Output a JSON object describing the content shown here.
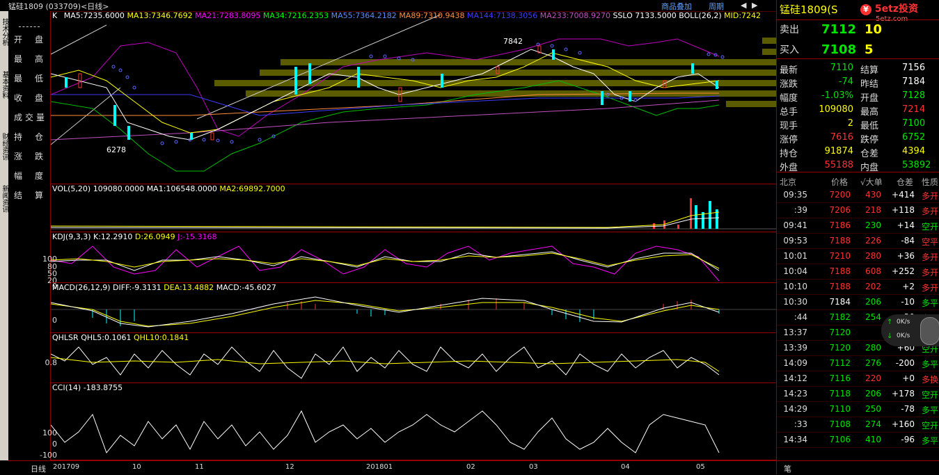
{
  "window": {
    "title": "锰硅1809 (033709)<日线>",
    "buttons": [
      "商品叠加",
      "周期"
    ]
  },
  "left_tabs": [
    "技术分析",
    "基本资料",
    "财经资讯",
    "新闻资讯"
  ],
  "left_menu": [
    "开盘",
    "最高",
    "最低",
    "收盘",
    "成交量",
    "持仓",
    "涨跌",
    "幅度",
    "结算"
  ],
  "main_pane": {
    "label": "K",
    "indicators": [
      {
        "text": "MA5:7235.6000",
        "color": "#ffffff"
      },
      {
        "text": "MA13:7346.7692",
        "color": "#ffff00"
      },
      {
        "text": "MA21:7283.8095",
        "color": "#ff00ff"
      },
      {
        "text": "MA34:7216.2353",
        "color": "#00ff00"
      },
      {
        "text": "MA55:7364.2182",
        "color": "#5a8cff"
      },
      {
        "text": "MA89:7310.9438",
        "color": "#ff8c3c"
      },
      {
        "text": "MA144:7138.3056",
        "color": "#3c3cff"
      },
      {
        "text": "MA233:7008.9270",
        "color": "#c050c0"
      },
      {
        "text": "SSLO 7133.5000",
        "color": "#ffffff"
      },
      {
        "text": "BOLL(26,2)",
        "color": "#ffffff"
      },
      {
        "text": "MID:7242",
        "color": "#ffff00"
      }
    ],
    "high_label": "7842",
    "low_label": "6278"
  },
  "vol_pane": {
    "title": "VOL(5,20)",
    "values": [
      {
        "text": "109080.0000",
        "color": "#fff"
      },
      {
        "text": "MA1:106548.0000",
        "color": "#fff"
      },
      {
        "text": "MA2:69892.7000",
        "color": "#ffff00"
      }
    ]
  },
  "kdj_pane": {
    "title": "KDJ(9,3,3)",
    "values": [
      {
        "text": "K:12.2910",
        "color": "#fff"
      },
      {
        "text": "D:26.0949",
        "color": "#ffff00"
      },
      {
        "text": "J:-15.3168",
        "color": "#ff00ff"
      }
    ],
    "yticks": [
      "100",
      "80",
      "50",
      "20",
      "0"
    ]
  },
  "macd_pane": {
    "title": "MACD(26,12,9)",
    "values": [
      {
        "text": "DIFF:-9.3131",
        "color": "#fff"
      },
      {
        "text": "DEA:13.4882",
        "color": "#ffff00"
      },
      {
        "text": "MACD:-45.6027",
        "color": "#fff"
      }
    ],
    "yticks": [
      "0"
    ]
  },
  "qhlsr_pane": {
    "title": "QHLSR",
    "values": [
      {
        "text": "QHL5:0.1061",
        "color": "#fff"
      },
      {
        "text": "QHL10:0.1841",
        "color": "#ffff00"
      }
    ],
    "yticks": [
      "0.8"
    ]
  },
  "cci_pane": {
    "title": "CCI(14)",
    "values": [
      {
        "text": "-183.8755",
        "color": "#fff"
      }
    ],
    "yticks": [
      "100",
      "0",
      "-100"
    ]
  },
  "x_axis": {
    "label": "日线",
    "ticks": [
      "201709",
      "10",
      "11",
      "12",
      "201801",
      "02",
      "03",
      "04",
      "05"
    ]
  },
  "right_panel": {
    "name": "锰硅1809",
    "code_partial": "(S",
    "sell": {
      "label": "卖出",
      "price": "7112",
      "qty": "10"
    },
    "buy": {
      "label": "买入",
      "price": "7108",
      "qty": "5"
    },
    "stats": [
      {
        "l1": "最新",
        "v1": "7110",
        "c1": "green",
        "l2": "结算",
        "v2": "7156",
        "c2": "white"
      },
      {
        "l1": "涨跌",
        "v1": "-74",
        "c1": "green",
        "l2": "昨结",
        "v2": "7184",
        "c2": "white"
      },
      {
        "l1": "幅度",
        "v1": "-1.03%",
        "c1": "green",
        "l2": "开盘",
        "v2": "7128",
        "c2": "green"
      },
      {
        "l1": "总手",
        "v1": "109080",
        "c1": "yellow",
        "l2": "最高",
        "v2": "7214",
        "c2": "red"
      },
      {
        "l1": "现手",
        "v1": "2",
        "c1": "yellow",
        "l2": "最低",
        "v2": "7100",
        "c2": "green"
      },
      {
        "l1": "涨停",
        "v1": "7616",
        "c1": "red",
        "l2": "跌停",
        "v2": "6752",
        "c2": "green"
      },
      {
        "l1": "持仓",
        "v1": "91874",
        "c1": "yellow",
        "l2": "仓差",
        "v2": "4394",
        "c2": "yellow"
      },
      {
        "l1": "外盘",
        "v1": "55188",
        "c1": "red",
        "l2": "内盘",
        "v2": "53892",
        "c2": "green"
      }
    ],
    "tick_header": [
      "北京",
      "价格",
      "√大单",
      "仓差",
      "性质"
    ],
    "ticks": [
      {
        "time": "09:35",
        "price": "7200",
        "pc": "red",
        "vol": "430",
        "vc": "red",
        "oi": "+414",
        "oic": "white",
        "nat": "多开",
        "nc": "red"
      },
      {
        "time": ":39",
        "price": "7206",
        "pc": "red",
        "vol": "218",
        "vc": "red",
        "oi": "+118",
        "oic": "white",
        "nat": "多开",
        "nc": "red"
      },
      {
        "time": "09:41",
        "price": "7186",
        "pc": "red",
        "vol": "230",
        "vc": "green",
        "oi": "+14",
        "oic": "white",
        "nat": "空开",
        "nc": "green"
      },
      {
        "time": "09:53",
        "price": "7188",
        "pc": "red",
        "vol": "226",
        "vc": "red",
        "oi": "-84",
        "oic": "white",
        "nat": "空平",
        "nc": "red"
      },
      {
        "time": "10:01",
        "price": "7210",
        "pc": "red",
        "vol": "280",
        "vc": "red",
        "oi": "+36",
        "oic": "white",
        "nat": "多开",
        "nc": "red"
      },
      {
        "time": "10:04",
        "price": "7188",
        "pc": "red",
        "vol": "608",
        "vc": "red",
        "oi": "+252",
        "oic": "white",
        "nat": "多开",
        "nc": "red"
      },
      {
        "time": "10:10",
        "price": "7188",
        "pc": "red",
        "vol": "202",
        "vc": "red",
        "oi": "+2",
        "oic": "white",
        "nat": "多开",
        "nc": "red"
      },
      {
        "time": "10:30",
        "price": "7184",
        "pc": "white",
        "vol": "206",
        "vc": "green",
        "oi": "-10",
        "oic": "white",
        "nat": "多平",
        "nc": "green"
      },
      {
        "time": ":44",
        "price": "7182",
        "pc": "green",
        "vol": "254",
        "vc": "green",
        "oi": "+30",
        "oic": "white",
        "nat": "空开",
        "nc": "green"
      },
      {
        "time": "13:37",
        "price": "7120",
        "pc": "green",
        "vol": "",
        "vc": "green",
        "oi": "",
        "oic": "white",
        "nat": "",
        "nc": "green"
      },
      {
        "time": "13:39",
        "price": "7120",
        "pc": "green",
        "vol": "280",
        "vc": "green",
        "oi": "+60",
        "oic": "white",
        "nat": "空开",
        "nc": "green"
      },
      {
        "time": "14:09",
        "price": "7112",
        "pc": "green",
        "vol": "276",
        "vc": "green",
        "oi": "-200",
        "oic": "white",
        "nat": "多平",
        "nc": "green"
      },
      {
        "time": "14:12",
        "price": "7116",
        "pc": "green",
        "vol": "220",
        "vc": "red",
        "oi": "+0",
        "oic": "white",
        "nat": "多换",
        "nc": "red"
      },
      {
        "time": "14:23",
        "price": "7118",
        "pc": "green",
        "vol": "206",
        "vc": "green",
        "oi": "+178",
        "oic": "white",
        "nat": "空开",
        "nc": "green"
      },
      {
        "time": "14:29",
        "price": "7110",
        "pc": "green",
        "vol": "250",
        "vc": "green",
        "oi": "-78",
        "oic": "white",
        "nat": "多平",
        "nc": "green"
      },
      {
        "time": ":33",
        "price": "7108",
        "pc": "green",
        "vol": "274",
        "vc": "green",
        "oi": "+160",
        "oic": "white",
        "nat": "空开",
        "nc": "green"
      },
      {
        "time": "14:34",
        "price": "7106",
        "pc": "green",
        "vol": "410",
        "vc": "green",
        "oi": "-96",
        "oic": "white",
        "nat": "多平",
        "nc": "green"
      }
    ],
    "speed": [
      "0K/s",
      "0K/s"
    ],
    "bottom_tab": "笔"
  },
  "watermark": {
    "text": "5etz投资",
    "sub": "5etz.com"
  }
}
